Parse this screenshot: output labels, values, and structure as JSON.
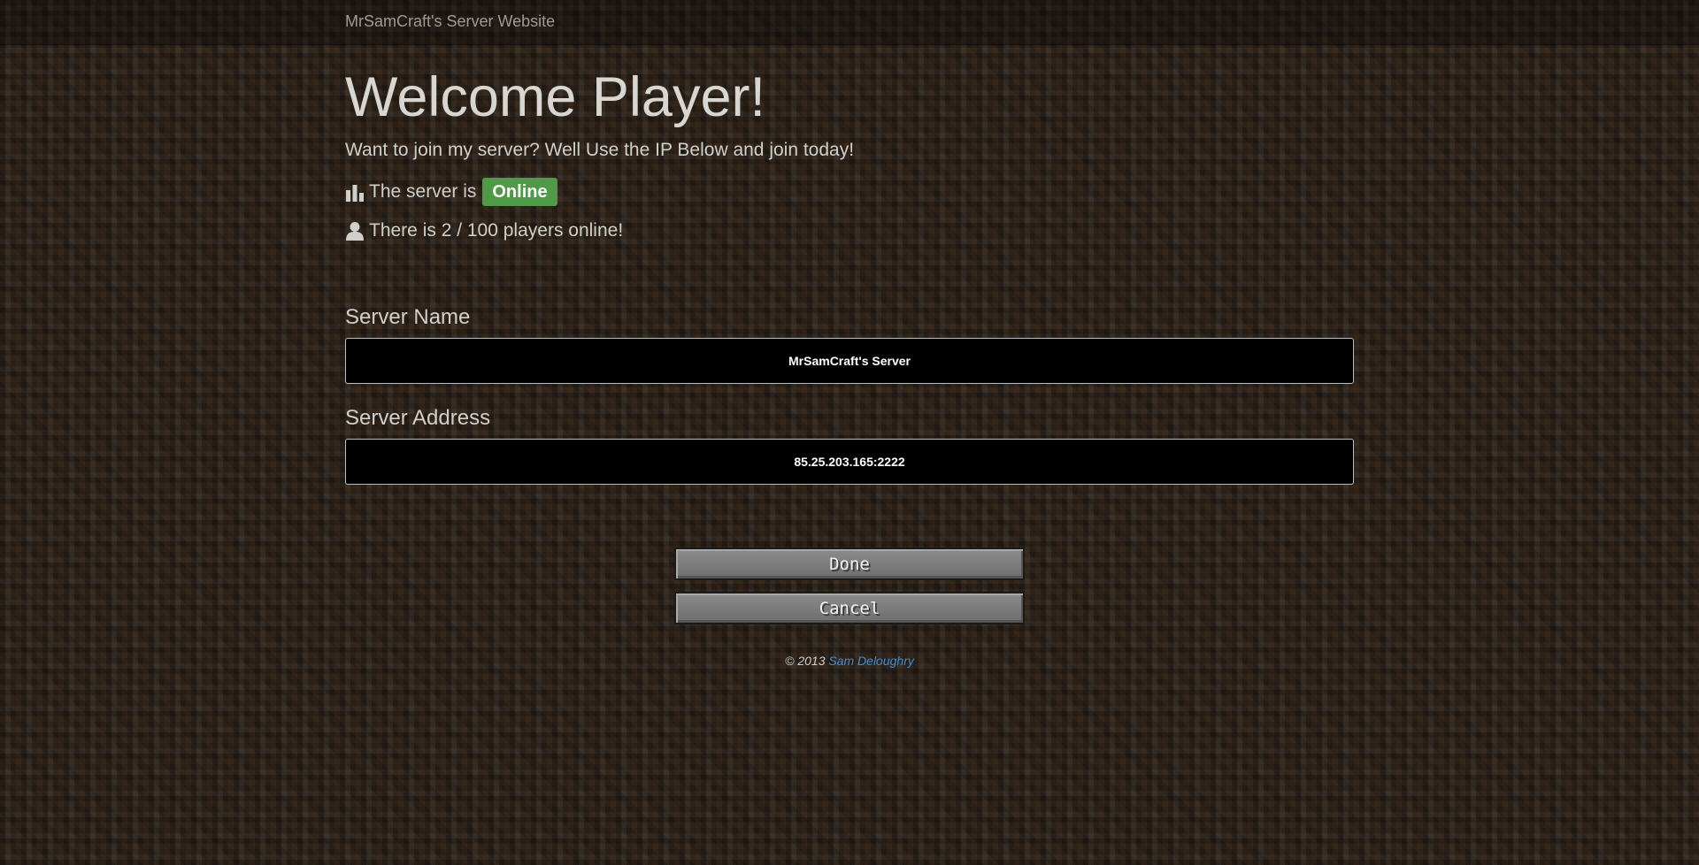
{
  "header": {
    "brand": "MrSamCraft's Server Website"
  },
  "hero": {
    "title": "Welcome Player!",
    "lead": "Want to join my server? Well Use the IP Below and join today!"
  },
  "status": {
    "prefix": "The server is",
    "badge": "Online",
    "badge_color": "#4e9a47",
    "icon": "bar-chart-icon"
  },
  "players": {
    "text": "There is 2 / 100 players online!",
    "icon": "user-icon"
  },
  "form": {
    "server_name_label": "Server Name",
    "server_name_value": "MrSamCraft's Server",
    "server_address_label": "Server Address",
    "server_address_value": "85.25.203.165:2222"
  },
  "buttons": {
    "done_label": "Done",
    "cancel_label": "Cancel"
  },
  "footer": {
    "copyright": "© 2013",
    "author": "Sam Deloughry",
    "link_color": "#3d8fd8"
  }
}
